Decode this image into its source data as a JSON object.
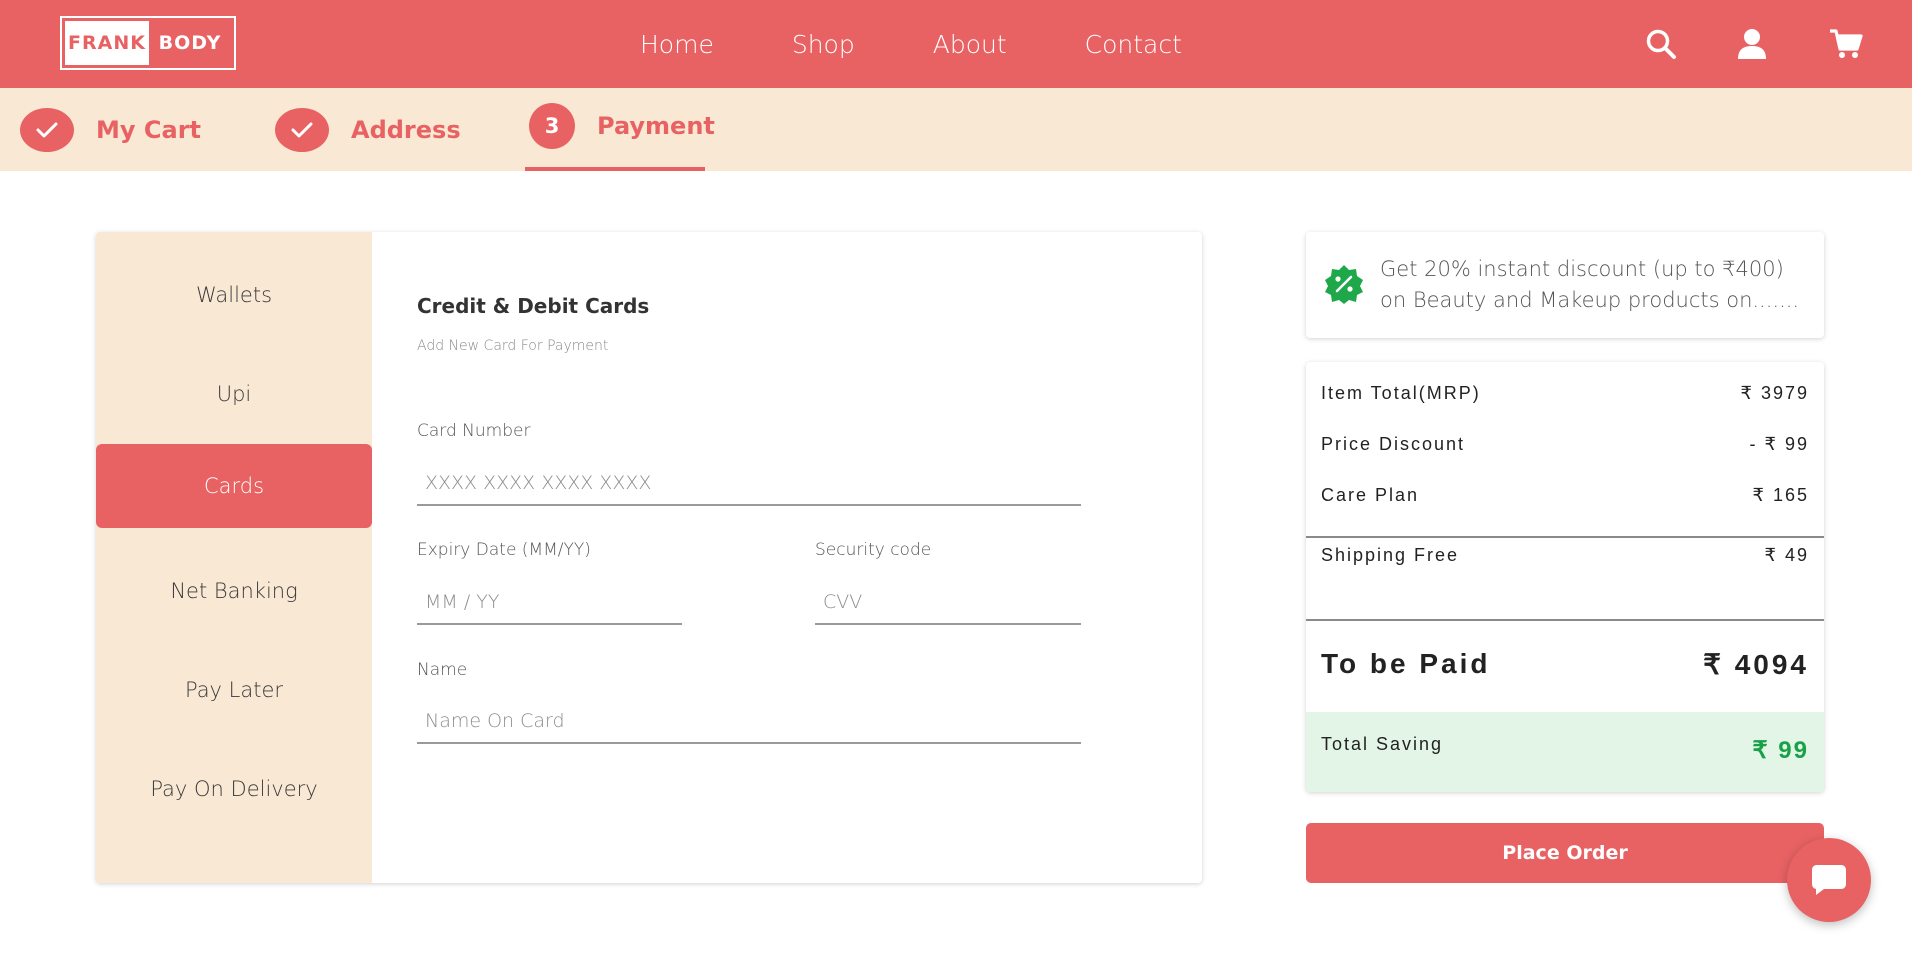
{
  "brand": {
    "part1": "FRANK",
    "part2": "BODY"
  },
  "nav": {
    "items": [
      "Home",
      "Shop",
      "About",
      "Contact"
    ]
  },
  "header_icons": [
    "search-icon",
    "user-icon",
    "cart-icon"
  ],
  "steps": [
    {
      "label": "My Cart",
      "state": "done",
      "marker": ""
    },
    {
      "label": "Address",
      "state": "done",
      "marker": ""
    },
    {
      "label": "Payment",
      "state": "active",
      "marker": "3"
    }
  ],
  "payment_methods": [
    "Wallets",
    "Upi",
    "Cards",
    "Net Banking",
    "Pay Later",
    "Pay On Delivery"
  ],
  "active_payment_method": "Cards",
  "card_form": {
    "title": "Credit & Debit Cards",
    "subtitle": "Add New Card For Payment",
    "card_number_label": "Card Number",
    "card_number_placeholder": "XXXX XXXX XXXX XXXX",
    "expiry_label": "Expiry Date (MM/YY)",
    "expiry_placeholder": "MM / YY",
    "cvv_label": "Security code",
    "cvv_placeholder": "CVV",
    "name_label": "Name",
    "name_placeholder": "Name On Card"
  },
  "offer": {
    "text": "Get 20% instant discount (up to ₹400) on Beauty and Makeup products on......."
  },
  "summary": {
    "item_total_label": "Item Total(MRP)",
    "item_total_value": "₹ 3979",
    "discount_label": "Price Discount",
    "discount_value": "- ₹ 99",
    "care_label": "Care Plan",
    "care_value": "₹ 165",
    "shipping_label": "Shipping Free",
    "shipping_value": "₹ 49",
    "to_pay_label": "To be Paid",
    "to_pay_value": "₹ 4094",
    "saving_label": "Total Saving",
    "saving_value": "₹ 99"
  },
  "place_order_label": "Place Order",
  "colors": {
    "brand": "#e86264",
    "cream": "#f9e8d4",
    "saving_bg": "#e3f5e6",
    "saving_text": "#19a14a",
    "offer_icon": "#1fa84a"
  }
}
